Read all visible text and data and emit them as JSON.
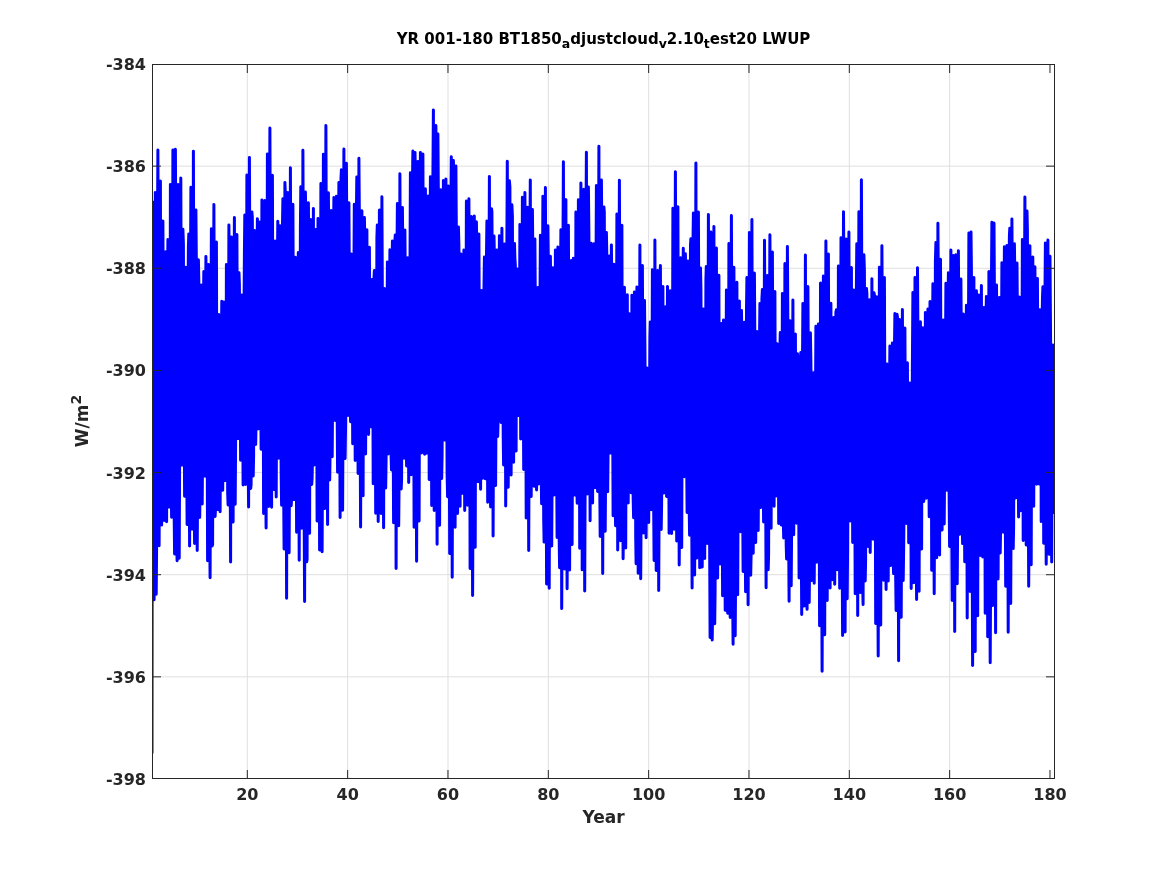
{
  "figure": {
    "title": "YR 001-180 BT1850$_{a}$djustcloud$_{v}$2.10$_{t}$est20 LWUP",
    "xlabel": "Year",
    "ylabel": "W/m$^{2}$",
    "x_tick_labels": [
      "20",
      "40",
      "60",
      "80",
      "100",
      "120",
      "140",
      "160",
      "180"
    ],
    "y_tick_labels": [
      "-384",
      "-386",
      "-388",
      "-390",
      "-392",
      "-394",
      "-396",
      "-398"
    ]
  }
}
